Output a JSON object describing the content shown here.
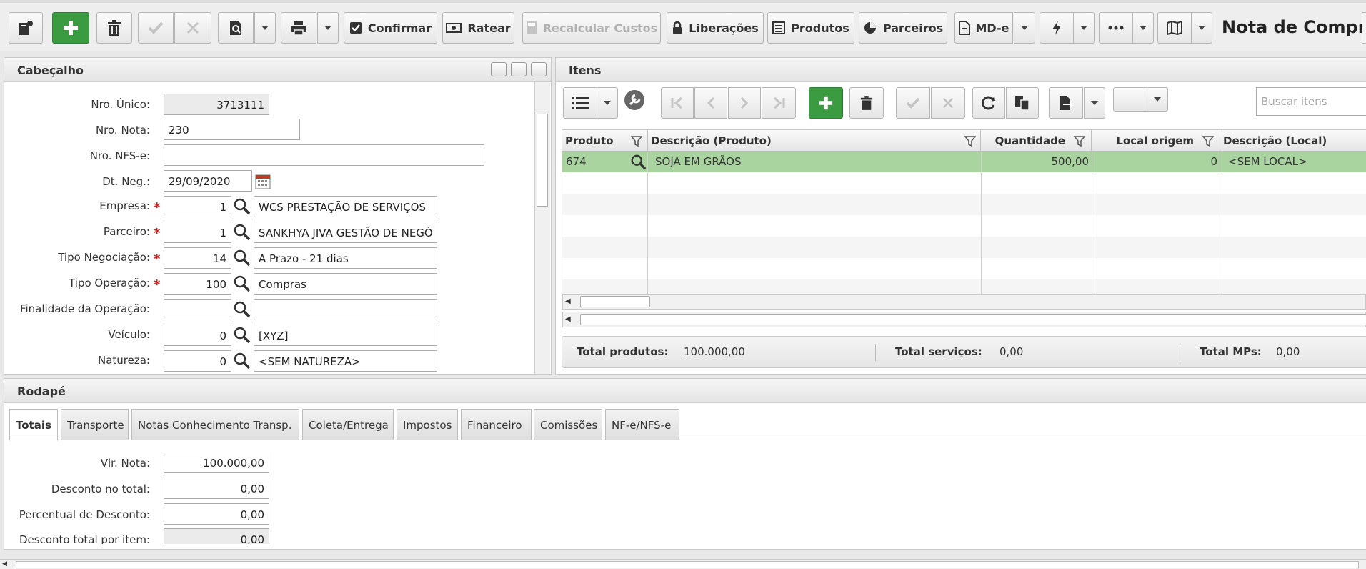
{
  "toolbar": {
    "confirmar": "Confirmar",
    "ratear": "Ratear",
    "recalcular": "Recalcular Custos",
    "liberacoes": "Liberações",
    "produtos": "Produtos",
    "parceiros": "Parceiros",
    "mde": "MD-e",
    "title": "Nota de Compra"
  },
  "header_panel": {
    "title": "Cabeçalho",
    "fields": {
      "nro_unico": {
        "label": "Nro. Único:",
        "value": "3713111"
      },
      "nro_nota": {
        "label": "Nro. Nota:",
        "value": "230"
      },
      "nro_nfse": {
        "label": "Nro. NFS-e:",
        "value": ""
      },
      "dt_neg": {
        "label": "Dt. Neg.:",
        "value": "29/09/2020"
      },
      "empresa": {
        "label": "Empresa:",
        "code": "1",
        "desc": "WCS PRESTAÇÃO DE SERVIÇOS"
      },
      "parceiro": {
        "label": "Parceiro:",
        "code": "1",
        "desc": "SANKHYA JIVA GESTÃO DE NEGÓ"
      },
      "tipo_negociacao": {
        "label": "Tipo Negociação:",
        "code": "14",
        "desc": "A Prazo - 21 dias"
      },
      "tipo_operacao": {
        "label": "Tipo Operação:",
        "code": "100",
        "desc": "Compras"
      },
      "finalidade": {
        "label": "Finalidade da Operação:",
        "code": "",
        "desc": ""
      },
      "veiculo": {
        "label": "Veículo:",
        "code": "0",
        "desc": "[XYZ]"
      },
      "natureza": {
        "label": "Natureza:",
        "code": "0",
        "desc": "<SEM NATUREZA>"
      }
    }
  },
  "items_panel": {
    "title": "Itens",
    "search_placeholder": "Buscar itens",
    "columns": {
      "produto": "Produto",
      "descricao": "Descrição (Produto)",
      "quantidade": "Quantidade",
      "local_origem": "Local origem",
      "descricao_local": "Descrição (Local)"
    },
    "rows": [
      {
        "produto": "674",
        "descricao": "SOJA EM GRÃOS",
        "quantidade": "500,00",
        "local_origem": "0",
        "descricao_local": "<SEM LOCAL>"
      }
    ],
    "totals": {
      "produtos_label": "Total produtos:",
      "produtos_value": "100.000,00",
      "servicos_label": "Total serviços:",
      "servicos_value": "0,00",
      "mps_label": "Total MPs:",
      "mps_value": "0,00"
    }
  },
  "footer_panel": {
    "title": "Rodapé",
    "tabs": [
      "Totais",
      "Transporte",
      "Notas Conhecimento Transp.",
      "Coleta/Entrega",
      "Impostos",
      "Financeiro",
      "Comissões",
      "NF-e/NFS-e"
    ],
    "fields": {
      "vlr_nota": {
        "label": "Vlr. Nota:",
        "value": "100.000,00"
      },
      "desconto_total": {
        "label": "Desconto no total:",
        "value": "0,00"
      },
      "perc_desconto": {
        "label": "Percentual de Desconto:",
        "value": "0,00"
      },
      "desc_total_item": {
        "label": "Desconto total por item:",
        "value": "0,00"
      }
    }
  },
  "colors": {
    "accent_green": "#3a9b41",
    "selected_row": "#a9d4a0",
    "required": "#d32020"
  }
}
